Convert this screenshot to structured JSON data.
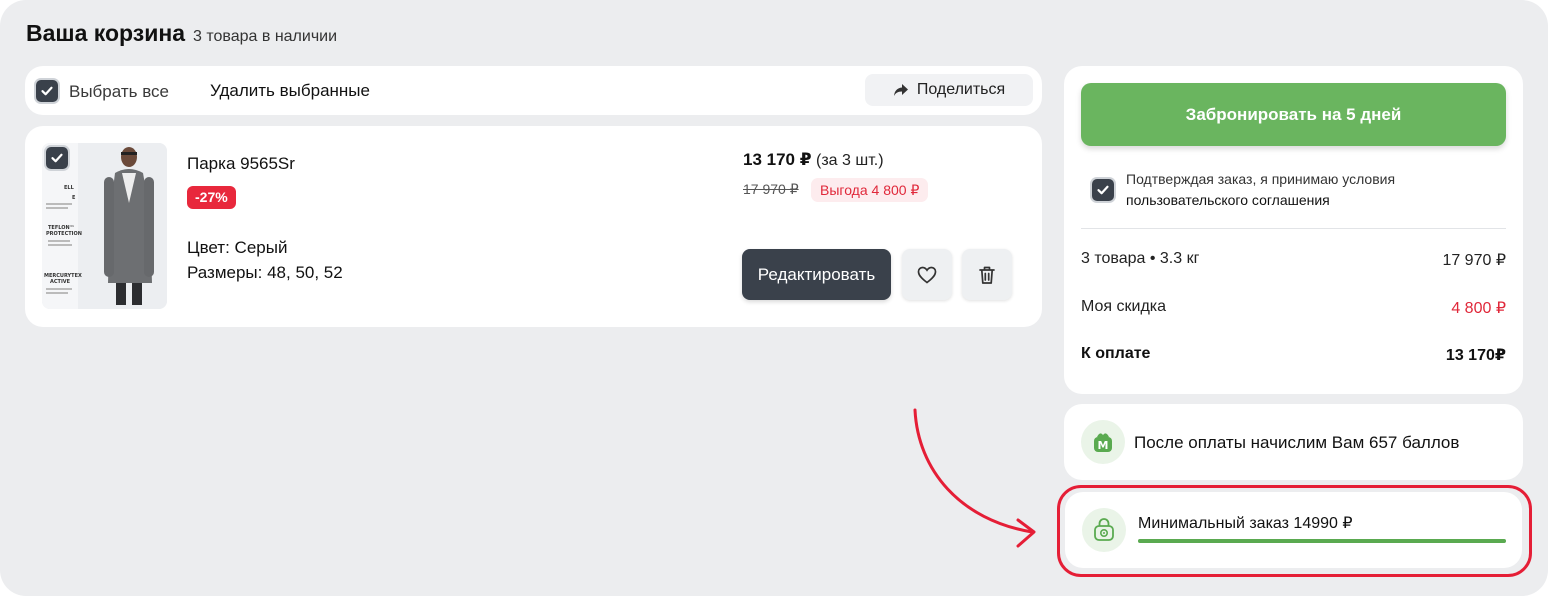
{
  "header": {
    "title": "Ваша корзина",
    "subtitle": "3 товара в наличии"
  },
  "toolbar": {
    "select_all_label": "Выбрать все",
    "select_all_checked": true,
    "delete_selected_label": "Удалить выбранные",
    "share_label": "Поделиться"
  },
  "product": {
    "checked": true,
    "name": "Парка 9565Sr",
    "discount": "-27%",
    "price": "13 170 ₽",
    "price_note": "(за 3 шт.)",
    "old_price": "17 970 ₽",
    "savings": "Выгода 4 800 ₽",
    "color_line": "Цвет: Серый",
    "sizes_line": "Размеры: 48, 50, 52",
    "edit_label": "Редактировать",
    "image_texts": [
      "ELL",
      "E",
      "TEFLON™",
      "PROTECTION",
      "MERCURYTEX",
      "ACTIVE"
    ]
  },
  "summary": {
    "book_button": "Забронировать на 5 дней",
    "agree_checked": true,
    "agree_text": "Подтверждая заказ, я принимаю условия",
    "agree_link": "пользовательского соглашения",
    "items_label": "3 товара • 3.3 кг",
    "items_value": "17 970 ₽",
    "discount_label": "Моя скидка",
    "discount_value": "4 800 ₽",
    "total_label": "К оплате",
    "total_value": "13 170₽"
  },
  "bonus": {
    "text": "После оплаты начислим Вам 657 баллов",
    "icon_letter": "М"
  },
  "min_order": {
    "text": "Минимальный заказ 14990 ₽",
    "progress_percent": 100
  },
  "colors": {
    "accent_green": "#6ab55f",
    "dark_button": "#3a414b",
    "discount_red": "#e8283c",
    "highlight_red": "#e51e36"
  }
}
